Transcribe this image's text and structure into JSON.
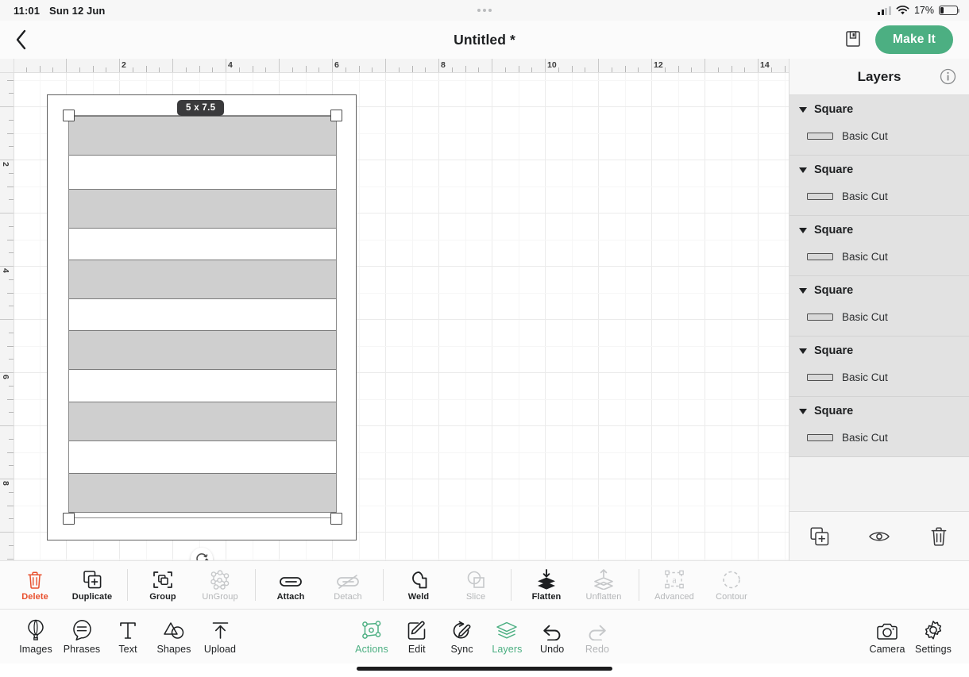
{
  "status_bar": {
    "time": "11:01",
    "date": "Sun 12 Jun",
    "battery_percent": "17%",
    "battery_level": 17,
    "wifi_icon": "wifi-icon",
    "cellular_icon": "cellular-signal-icon"
  },
  "header": {
    "back_icon": "back-chevron-icon",
    "title": "Untitled *",
    "save_icon": "save-floppy-icon",
    "make_it_label": "Make It",
    "accent_color": "#4caf82"
  },
  "canvas": {
    "ruler_unit": "inches",
    "ruler_h_labels": [
      "2",
      "4",
      "6",
      "8",
      "10",
      "12",
      "14"
    ],
    "ruler_v_labels": [
      "2",
      "4",
      "6",
      "8"
    ],
    "pixels_per_inch": 67,
    "size_badge": "5 x 7.5",
    "artboard": {
      "width_in": "5",
      "height_in": "7.5"
    },
    "rotate_icon": "rotate-handle-icon",
    "shape_count": 6,
    "shape_fill": "#cfcfcf",
    "shape_stroke": "#7b7b7b"
  },
  "layers": {
    "title": "Layers",
    "info_icon": "info-circle-icon",
    "groups": [
      {
        "name": "Square",
        "child": {
          "label": "Basic Cut",
          "icon": "cut-line-thumbnail"
        }
      },
      {
        "name": "Square",
        "child": {
          "label": "Basic Cut",
          "icon": "cut-line-thumbnail"
        }
      },
      {
        "name": "Square",
        "child": {
          "label": "Basic Cut",
          "icon": "cut-line-thumbnail"
        }
      },
      {
        "name": "Square",
        "child": {
          "label": "Basic Cut",
          "icon": "cut-line-thumbnail"
        }
      },
      {
        "name": "Square",
        "child": {
          "label": "Basic Cut",
          "icon": "cut-line-thumbnail"
        }
      },
      {
        "name": "Square",
        "child": {
          "label": "Basic Cut",
          "icon": "cut-line-thumbnail"
        }
      }
    ],
    "footer": [
      {
        "name": "duplicate-layer-button",
        "icon": "duplicate-squares-icon"
      },
      {
        "name": "visibility-button",
        "icon": "eye-icon"
      },
      {
        "name": "delete-layer-button",
        "icon": "trash-icon"
      }
    ]
  },
  "toolbar": {
    "items": [
      {
        "label": "Delete",
        "icon": "trash-icon",
        "state": "danger"
      },
      {
        "label": "Duplicate",
        "icon": "duplicate-icon",
        "state": "enabled"
      },
      {
        "label": "Group",
        "icon": "group-icon",
        "state": "enabled"
      },
      {
        "label": "UnGroup",
        "icon": "ungroup-icon",
        "state": "disabled"
      },
      {
        "label": "Attach",
        "icon": "paperclip-icon",
        "state": "enabled"
      },
      {
        "label": "Detach",
        "icon": "paperclip-slash-icon",
        "state": "disabled"
      },
      {
        "label": "Weld",
        "icon": "weld-icon",
        "state": "enabled"
      },
      {
        "label": "Slice",
        "icon": "slice-icon",
        "state": "disabled"
      },
      {
        "label": "Flatten",
        "icon": "flatten-icon",
        "state": "enabled"
      },
      {
        "label": "Unflatten",
        "icon": "unflatten-icon",
        "state": "disabled"
      },
      {
        "label": "Advanced",
        "icon": "advanced-icon",
        "state": "disabled"
      },
      {
        "label": "Contour",
        "icon": "contour-icon",
        "state": "disabled"
      }
    ]
  },
  "bottom_nav": {
    "left": [
      {
        "label": "Images",
        "icon": "balloon-icon",
        "state": "enabled"
      },
      {
        "label": "Phrases",
        "icon": "speech-bubble-icon",
        "state": "enabled"
      },
      {
        "label": "Text",
        "icon": "text-t-icon",
        "state": "enabled"
      },
      {
        "label": "Shapes",
        "icon": "shapes-icon",
        "state": "enabled"
      },
      {
        "label": "Upload",
        "icon": "upload-arrow-icon",
        "state": "enabled"
      }
    ],
    "center": [
      {
        "label": "Actions",
        "icon": "actions-nodes-icon",
        "state": "active"
      },
      {
        "label": "Edit",
        "icon": "edit-pencil-icon",
        "state": "enabled"
      },
      {
        "label": "Sync",
        "icon": "sync-pencil-icon",
        "state": "enabled"
      },
      {
        "label": "Layers",
        "icon": "layers-stack-icon",
        "state": "active"
      },
      {
        "label": "Undo",
        "icon": "undo-arrow-icon",
        "state": "enabled"
      },
      {
        "label": "Redo",
        "icon": "redo-arrow-icon",
        "state": "disabled"
      }
    ],
    "right": [
      {
        "label": "Camera",
        "icon": "camera-icon",
        "state": "enabled"
      },
      {
        "label": "Settings",
        "icon": "gear-icon",
        "state": "enabled"
      }
    ]
  }
}
